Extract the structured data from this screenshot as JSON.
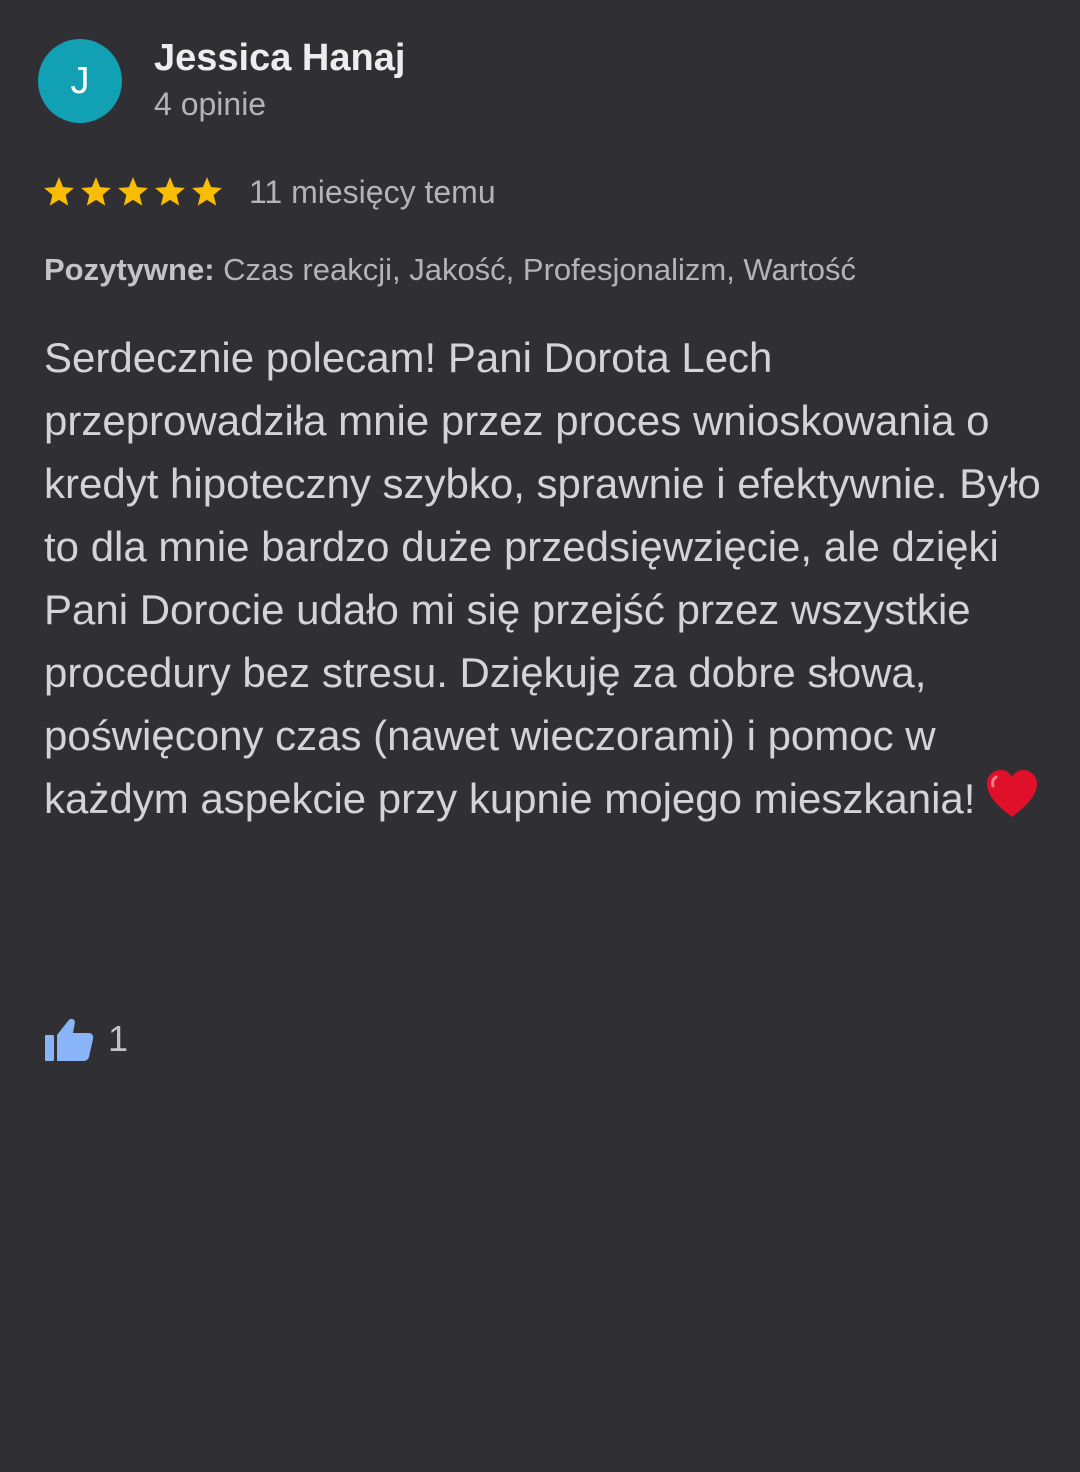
{
  "author": {
    "initial": "J",
    "name": "Jessica Hanaj",
    "meta": "4 opinie",
    "avatar_color": "#11a0b4"
  },
  "rating": {
    "stars": 5,
    "max_stars": 5,
    "star_color": "#fbbc04",
    "time_ago": "11 miesięcy temu"
  },
  "attributes": {
    "label": "Pozytywne:",
    "values": "Czas reakcji, Jakość, Profesjonalizm, Wartość"
  },
  "review": {
    "text": "Serdecznie polecam! Pani Dorota Lech przeprowadziła mnie przez proces wnioskowania o kredyt hipoteczny szybko, sprawnie i efektywnie. Było to dla mnie bardzo duże przedsięwzięcie, ale dzięki Pani Dorocie udało mi się przejść przez wszystkie procedury bez stresu. Dziękuję za dobre słowa, poświęcony czas (nawet wieczorami) i pomoc w każdym aspekcie przy kupnie mojego mieszkania!",
    "emoji": "heart-emoji"
  },
  "likes": {
    "icon": "thumbs-up-icon",
    "count": "1",
    "icon_color": "#8ab4f8"
  }
}
